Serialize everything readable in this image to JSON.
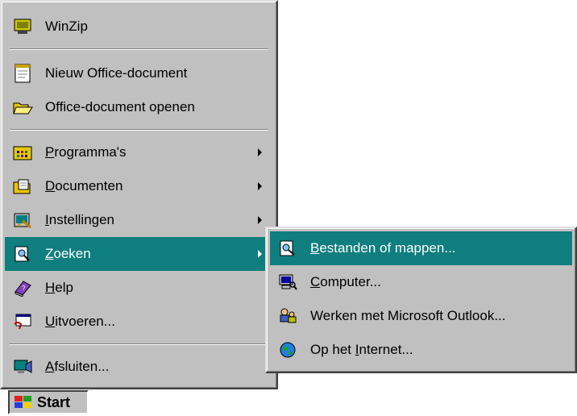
{
  "start_menu": {
    "items": [
      {
        "pre": "",
        "ul": "",
        "post": "WinZip",
        "icon": "winzip-icon"
      },
      {
        "pre": "",
        "ul": "",
        "post": "Nieuw Office-document",
        "icon": "new-office-document-icon"
      },
      {
        "pre": "",
        "ul": "",
        "post": "Office-document openen",
        "icon": "open-folder-icon"
      },
      {
        "pre": "",
        "ul": "P",
        "post": "rogramma's",
        "icon": "programs-folder-icon",
        "submenu": true
      },
      {
        "pre": "",
        "ul": "D",
        "post": "ocumenten",
        "icon": "documents-folder-icon",
        "submenu": true
      },
      {
        "pre": "",
        "ul": "I",
        "post": "nstellingen",
        "icon": "settings-icon",
        "submenu": true
      },
      {
        "pre": "",
        "ul": "Z",
        "post": "oeken",
        "icon": "find-icon",
        "submenu": true,
        "active": true
      },
      {
        "pre": "",
        "ul": "H",
        "post": "elp",
        "icon": "help-book-icon"
      },
      {
        "pre": "",
        "ul": "U",
        "post": "itvoeren...",
        "icon": "run-icon"
      },
      {
        "pre": "",
        "ul": "A",
        "post": "fsluiten...",
        "icon": "shutdown-icon"
      }
    ]
  },
  "submenu": {
    "items": [
      {
        "pre": "",
        "ul": "B",
        "post": "estanden of mappen...",
        "icon": "find-files-icon",
        "active": true
      },
      {
        "pre": "",
        "ul": "C",
        "post": "omputer...",
        "icon": "find-computer-icon"
      },
      {
        "pre": "Werken met Microsoft Outlook...",
        "ul": "",
        "post": "",
        "icon": "outlook-people-icon"
      },
      {
        "pre": "Op het ",
        "ul": "I",
        "post": "nternet...",
        "icon": "internet-globe-icon"
      }
    ]
  },
  "taskbar": {
    "start_label": "Start"
  },
  "colors": {
    "menu_bg": "#c0c0c0",
    "highlight": "#0e7e7e"
  }
}
